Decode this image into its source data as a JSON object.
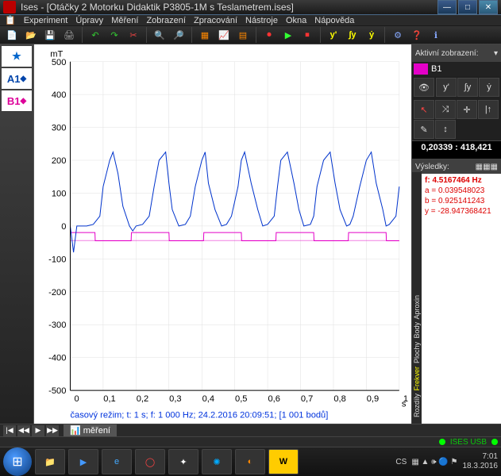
{
  "title": "Ises - [Otáčky 2 Motorku Didaktik P3805-1M s Teslametrem.ises]",
  "winbtns": {
    "min": "—",
    "max": "□",
    "close": "✕"
  },
  "menu": [
    "Experiment",
    "Úpravy",
    "Měření",
    "Zobrazení",
    "Zpracování",
    "Nástroje",
    "Okna",
    "Nápověda"
  ],
  "leftbar": {
    "star": "★",
    "a1": "A1",
    "b1": "B1"
  },
  "right": {
    "header": "Aktivní zobrazení:",
    "channel": "B1",
    "tools_row1": [
      "👁",
      "y'",
      "∫y",
      "ẏ"
    ],
    "tools_row2": [
      "↖",
      "⤨",
      "✛",
      "|↑",
      "✎",
      "↕"
    ],
    "coord": "0,20339 : 418,421",
    "results_header": "Výsledky:",
    "side_labels": [
      "Rozdíly",
      "Frekver",
      "Plochy",
      "Body",
      "Aproxin"
    ],
    "results": {
      "f": "f:   4.5167464  Hz",
      "a": "a = 0.039548023",
      "b": "b = 0.925141243",
      "y": "y = -28.947368421"
    }
  },
  "plot": {
    "ylabel": "mT",
    "xlabel": "s",
    "footer": "časový režim; t: 1 s; f: 1 000 Hz; 24.2.2016  20:09:51; [1 001 bodů]"
  },
  "nav": {
    "first": "|◀",
    "prev": "◀◀",
    "play": "▶",
    "next": "▶▶",
    "tab": "📊 měření"
  },
  "status": {
    "conn": "ISES USB",
    "led": "●"
  },
  "taskbar": {
    "lang": "CS",
    "time": "7:01",
    "date": "18.3.2016"
  },
  "chart_data": {
    "type": "line",
    "xlabel": "s",
    "ylabel": "mT",
    "xlim": [
      0,
      1
    ],
    "ylim": [
      -500,
      500
    ],
    "xticks": [
      0,
      0.1,
      0.2,
      0.3,
      0.4,
      0.5,
      0.6,
      0.7,
      0.8,
      0.9,
      1
    ],
    "yticks": [
      -500,
      -400,
      -300,
      -200,
      -100,
      0,
      100,
      200,
      300,
      400,
      500
    ],
    "series": [
      {
        "name": "A1",
        "color": "#0033cc",
        "x": [
          0,
          0.01,
          0.02,
          0.03,
          0.05,
          0.07,
          0.09,
          0.1,
          0.12,
          0.13,
          0.145,
          0.16,
          0.18,
          0.19,
          0.2,
          0.22,
          0.24,
          0.255,
          0.27,
          0.29,
          0.3,
          0.31,
          0.33,
          0.35,
          0.365,
          0.38,
          0.4,
          0.41,
          0.42,
          0.44,
          0.46,
          0.475,
          0.49,
          0.51,
          0.52,
          0.53,
          0.55,
          0.57,
          0.585,
          0.6,
          0.62,
          0.63,
          0.64,
          0.66,
          0.68,
          0.695,
          0.71,
          0.73,
          0.74,
          0.75,
          0.77,
          0.79,
          0.805,
          0.82,
          0.84,
          0.85,
          0.86,
          0.88,
          0.9,
          0.915,
          0.93,
          0.95,
          0.96,
          0.97,
          0.99,
          1.0
        ],
        "y": [
          0,
          -80,
          0,
          0,
          0,
          5,
          30,
          120,
          200,
          225,
          160,
          60,
          0,
          -15,
          0,
          5,
          30,
          120,
          200,
          225,
          130,
          50,
          0,
          5,
          30,
          120,
          200,
          225,
          130,
          50,
          0,
          5,
          30,
          120,
          200,
          225,
          130,
          50,
          0,
          5,
          30,
          120,
          200,
          225,
          130,
          50,
          0,
          5,
          30,
          120,
          200,
          225,
          130,
          50,
          0,
          5,
          30,
          120,
          200,
          225,
          130,
          50,
          0,
          5,
          30,
          120
        ]
      },
      {
        "name": "B1",
        "color": "#e400c8",
        "x": [
          0,
          0.075,
          0.076,
          0.185,
          0.186,
          0.3,
          0.301,
          0.405,
          0.406,
          0.52,
          0.521,
          0.625,
          0.626,
          0.74,
          0.741,
          0.845,
          0.846,
          0.96,
          0.961,
          1.0
        ],
        "y": [
          -20,
          -20,
          -45,
          -45,
          -20,
          -20,
          -45,
          -45,
          -20,
          -20,
          -45,
          -45,
          -20,
          -20,
          -45,
          -45,
          -20,
          -20,
          -45,
          -45
        ]
      }
    ],
    "footer": "časový režim; t: 1 s; f: 1 000 Hz; 24.2.2016  20:09:51; [1 001 bodů]"
  }
}
